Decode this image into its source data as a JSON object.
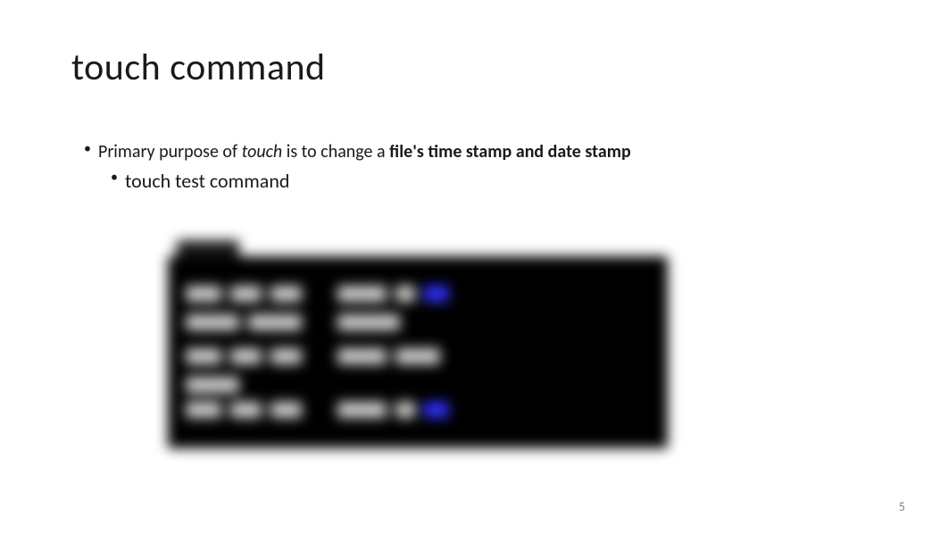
{
  "slide": {
    "title": "touch command",
    "bullet1_prefix": "Primary purpose of ",
    "bullet1_italic": "touch",
    "bullet1_middle": " is to change a ",
    "bullet1_bold": "file's time stamp and date stamp",
    "bullet2": "touch  test command",
    "pageNumber": "5"
  }
}
